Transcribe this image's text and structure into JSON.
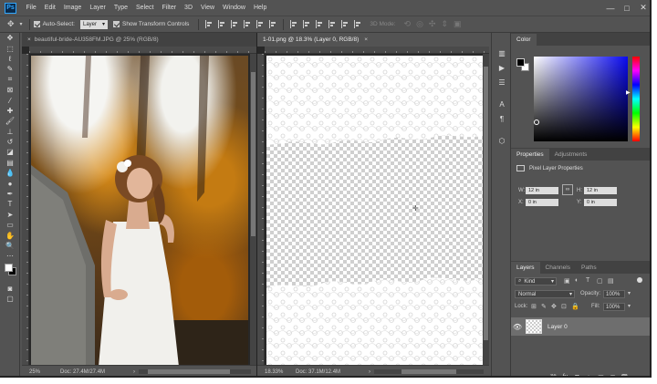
{
  "app": {
    "logo": "Ps"
  },
  "menu": [
    "File",
    "Edit",
    "Image",
    "Layer",
    "Type",
    "Select",
    "Filter",
    "3D",
    "View",
    "Window",
    "Help"
  ],
  "window_controls": {
    "minimize": "—",
    "maximize": "□",
    "close": "✕"
  },
  "options_bar": {
    "auto_select_label": "Auto-Select:",
    "auto_select_value": "Layer",
    "show_transform_label": "Show Transform Controls",
    "mode_3d_label": "3D Mode:"
  },
  "documents": [
    {
      "tab_title": "beautiful-bride-AU358FM.JPG @ 25% (RGB/8)",
      "zoom": "25%",
      "doc_info": "Doc: 27.4M/27.4M",
      "active": false
    },
    {
      "tab_title": "1-01.png @ 18.3% (Layer 0, RGB/8)",
      "zoom": "18.33%",
      "doc_info": "Doc: 37.1M/12.4M",
      "active": true
    }
  ],
  "color_panel": {
    "tab": "Color",
    "hue_indicator": "▶"
  },
  "properties_panel": {
    "tabs": [
      "Properties",
      "Adjustments"
    ],
    "title": "Pixel Layer Properties",
    "w_label": "W:",
    "w_value": "12 in",
    "h_label": "H:",
    "h_value": "12 in",
    "x_label": "X:",
    "x_value": "0 in",
    "y_label": "Y:",
    "y_value": "0 in",
    "link_icon": "∞"
  },
  "layers_panel": {
    "tabs": [
      "Layers",
      "Channels",
      "Paths"
    ],
    "filter_value": "Kind",
    "blend_mode": "Normal",
    "opacity_label": "Opacity:",
    "opacity_value": "100%",
    "lock_label": "Lock:",
    "fill_label": "Fill:",
    "fill_value": "100%",
    "layers": [
      {
        "name": "Layer 0",
        "visible": true
      }
    ],
    "bottom_icons": [
      "link-layers-icon",
      "fx-icon",
      "mask-icon",
      "adjustment-icon",
      "group-icon",
      "new-layer-icon",
      "trash-icon"
    ]
  },
  "colors": {
    "ui_dark": "#535353",
    "accent": "#31a8ff"
  }
}
